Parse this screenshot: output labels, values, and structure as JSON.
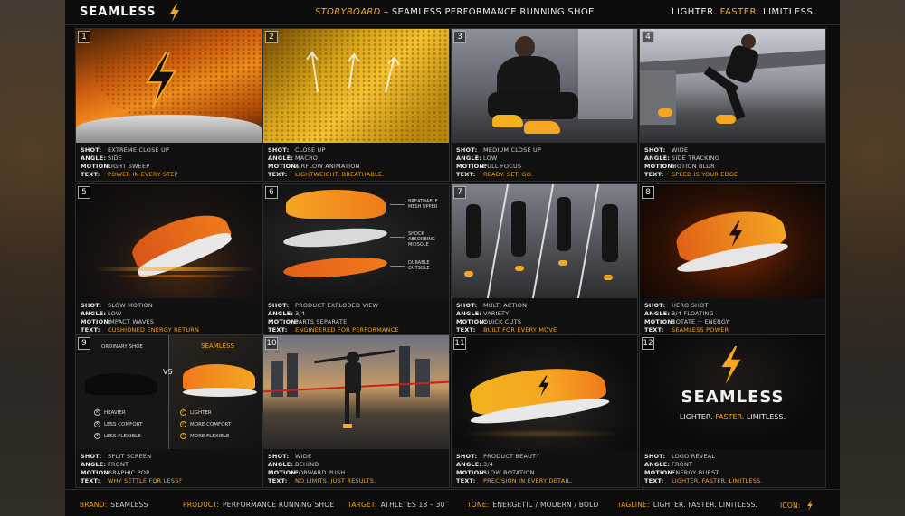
{
  "header": {
    "brand": "SEAMLESS",
    "storyboard_label": "STORYBOARD",
    "storyboard_title": " – SEAMLESS PERFORMANCE RUNNING SHOE",
    "tagline_parts": [
      "LIGHTER. ",
      "FASTER.",
      " LIMITLESS."
    ]
  },
  "panels": [
    {
      "num": "1",
      "shot": "EXTREME CLOSE UP",
      "angle": "SIDE",
      "motion": "LIGHT SWEEP",
      "text": "POWER IN EVERY STEP"
    },
    {
      "num": "2",
      "shot": "CLOSE UP",
      "angle": "MACRO",
      "motion": "AIRFLOW ANIMATION",
      "text": "LIGHTWEIGHT. BREATHABLE."
    },
    {
      "num": "3",
      "shot": "MEDIUM CLOSE UP",
      "angle": "LOW",
      "motion": "PULL FOCUS",
      "text": "READY. SET. GO."
    },
    {
      "num": "4",
      "shot": "WIDE",
      "angle": "SIDE TRACKING",
      "motion": "MOTION BLUR",
      "text": "SPEED IS YOUR EDGE"
    },
    {
      "num": "5",
      "shot": "SLOW MOTION",
      "angle": "LOW",
      "motion": "IMPACT WAVES",
      "text": "CUSHIONED ENERGY RETURN"
    },
    {
      "num": "6",
      "shot": "PRODUCT EXPLODED VIEW",
      "angle": "3/4",
      "motion": "PARTS SEPARATE",
      "text": "ENGINEERED FOR PERFORMANCE"
    },
    {
      "num": "7",
      "shot": "MULTI ACTION",
      "angle": "VARIETY",
      "motion": "QUICK CUTS",
      "text": "BUILT FOR EVERY MOVE"
    },
    {
      "num": "8",
      "shot": "HERO SHOT",
      "angle": "3/4 FLOATING",
      "motion": "ROTATE + ENERGY",
      "text": "SEAMLESS POWER"
    },
    {
      "num": "9",
      "shot": "SPLIT SCREEN",
      "angle": "FRONT",
      "motion": "GRAPHIC POP",
      "text": "WHY SETTLE FOR LESS?"
    },
    {
      "num": "10",
      "shot": "WIDE",
      "angle": "BEHIND",
      "motion": "FORWARD PUSH",
      "text": "NO LIMITS. JUST RESULTS."
    },
    {
      "num": "11",
      "shot": "PRODUCT BEAUTY",
      "angle": "3/4",
      "motion": "SLOW ROTATION",
      "text": "PRECISION IN EVERY DETAIL."
    },
    {
      "num": "12",
      "shot": "LOGO REVEAL",
      "angle": "FRONT",
      "motion": "ENERGY BURST",
      "text": "LIGHTER. FASTER. LIMITLESS."
    }
  ],
  "field_labels": {
    "shot": "SHOT:",
    "angle": "ANGLE:",
    "motion": "MOTION:",
    "text": "TEXT:"
  },
  "panel6_callouts": [
    "BREATHABLE MESH UPPER",
    "SHOCK ABSORBING MIDSOLE",
    "DURABLE OUTSOLE"
  ],
  "panel9": {
    "left_title": "ORDINARY SHOE",
    "right_title": "SEAMLESS",
    "vs": "VS",
    "left_items": [
      "HEAVIER",
      "LESS COMFORT",
      "LESS FLEXIBLE"
    ],
    "right_items": [
      "LIGHTER",
      "MORE COMFORT",
      "MORE FLEXIBLE"
    ]
  },
  "panel12": {
    "logo": "SEAMLESS",
    "tagline_parts": [
      "LIGHTER. ",
      "FASTER.",
      " LIMITLESS."
    ]
  },
  "footer": {
    "brand_label": "BRAND:",
    "brand": "SEAMLESS",
    "product_label": "PRODUCT:",
    "product": "PERFORMANCE RUNNING SHOE",
    "target_label": "TARGET:",
    "target": "ATHLETES 18 – 30",
    "tone_label": "TONE:",
    "tone": "ENERGETIC / MODERN / BOLD",
    "tagline_label": "TAGLINE:",
    "tagline": "LIGHTER. FASTER. LIMITLESS.",
    "icon_label": "ICON:"
  },
  "colors": {
    "accent": "#f5a623",
    "orange": "#f07a1a",
    "background": "#0d0d0d"
  }
}
